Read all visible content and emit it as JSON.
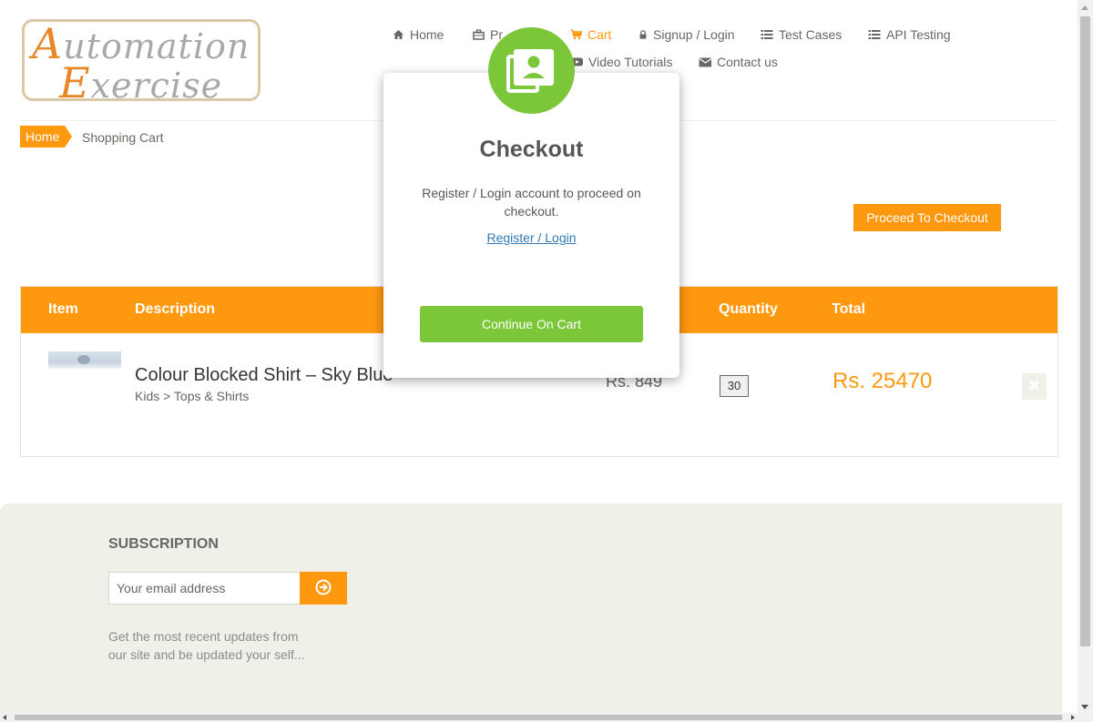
{
  "logo": {
    "line1_cap": "A",
    "line1_rest": "utomation",
    "line2_cap": "E",
    "line2_rest": "xercise"
  },
  "nav": {
    "home": "Home",
    "products": "Pr",
    "cart": "Cart",
    "signup": "Signup / Login",
    "test_cases": "Test Cases",
    "api_testing": "API Testing",
    "video_tutorials": "Video Tutorials",
    "contact": "Contact us"
  },
  "breadcrumb": {
    "home": "Home",
    "current": "Shopping Cart"
  },
  "proceed_button": "Proceed To Checkout",
  "cart": {
    "headers": [
      "Item",
      "Description",
      "Quantity",
      "Total"
    ],
    "rows": [
      {
        "name": "Colour Blocked Shirt – Sky Blue",
        "category": "Kids > Tops & Shirts",
        "price": "Rs. 849",
        "quantity": "30",
        "total": "Rs. 25470",
        "delete_icon": "✖"
      }
    ]
  },
  "footer": {
    "subscription_title": "SUBSCRIPTION",
    "email_placeholder": "Your email address",
    "note": "Get the most recent updates from our site and be updated your self..."
  },
  "modal": {
    "title": "Checkout",
    "text": "Register / Login account to proceed on checkout.",
    "link": "Register / Login",
    "button": "Continue On Cart"
  },
  "colors": {
    "accent": "#fe980f",
    "modal_green": "#7cc63a",
    "footer_bg": "#f0f0e9"
  },
  "icons": {
    "home": "home-icon",
    "products": "briefcase-icon",
    "cart": "shopping-cart-icon",
    "signup": "lock-icon",
    "test_cases": "list-icon",
    "api_testing": "list-icon",
    "video": "youtube-play-icon",
    "contact": "envelope-icon",
    "subscribe": "arrow-circle-right-icon",
    "modal_badge": "contact-card-icon"
  }
}
